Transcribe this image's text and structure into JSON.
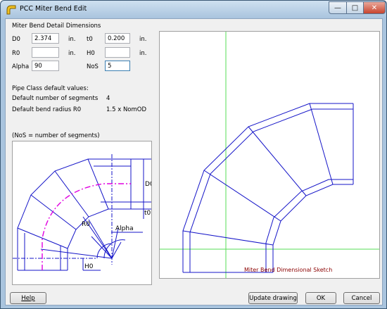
{
  "window": {
    "title": "PCC Miter Bend Edit"
  },
  "dimensions": {
    "group_title": "Miter Bend Detail Dimensions",
    "d0": {
      "label": "D0",
      "value": "2.374",
      "unit": "in."
    },
    "t0": {
      "label": "t0",
      "value": "0.200",
      "unit": "in."
    },
    "r0": {
      "label": "R0",
      "value": "",
      "unit": "in."
    },
    "h0": {
      "label": "H0",
      "value": "",
      "unit": "in."
    },
    "alpha": {
      "label": "Alpha",
      "value": "90"
    },
    "nos": {
      "label": "NoS",
      "value": "5"
    }
  },
  "defaults": {
    "heading": "Pipe Class default values:",
    "segments_label": "Default number of segments",
    "segments_value": "4",
    "radius_label": "Default bend radius R0",
    "radius_value": "1.5 x NomOD"
  },
  "small_sketch": {
    "caption": "(NoS = number of segments)",
    "labels": {
      "d0": "D0",
      "t0": "t0",
      "r0": "R0",
      "alpha": "Alpha",
      "h0": "H0"
    }
  },
  "big_sketch": {
    "caption": "Miter Bend Dimensional Sketch"
  },
  "buttons": {
    "help": "Help",
    "update": "Update drawing",
    "ok": "OK",
    "cancel": "Cancel"
  },
  "colors": {
    "outline": "#1414c8",
    "guide": "#55dd55",
    "centerline": "#e000e0",
    "caption": "#8b0000"
  }
}
